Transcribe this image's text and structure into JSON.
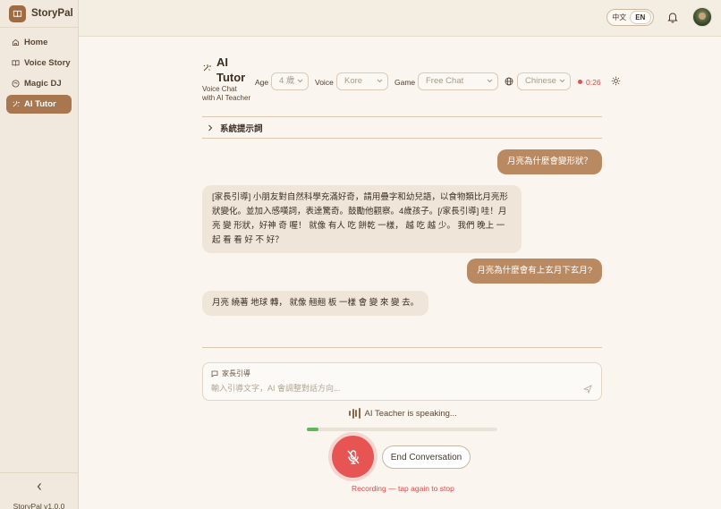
{
  "app": {
    "name": "StoryPal",
    "version": "StoryPal v1.0.0"
  },
  "sidebar": {
    "items": [
      {
        "label": "Home",
        "icon": "home-icon",
        "active": false
      },
      {
        "label": "Voice Story",
        "icon": "book-icon",
        "active": false
      },
      {
        "label": "Magic DJ",
        "icon": "disc-icon",
        "active": false
      },
      {
        "label": "AI Tutor",
        "icon": "sparkle-icon",
        "active": true
      }
    ]
  },
  "topbar": {
    "lang_zh": "中文",
    "lang_en": "EN",
    "active_lang": "EN"
  },
  "tutor": {
    "title": "AI Tutor",
    "subtitle": "Voice Chat with AI Teacher",
    "age_label": "Age",
    "age_value": "4 歲",
    "voice_label": "Voice",
    "voice_value": "Kore",
    "game_label": "Game",
    "game_value": "Free Chat",
    "language_value": "Chinese",
    "timer": "0:26"
  },
  "system_prompt": {
    "label": "系統提示詞"
  },
  "messages": [
    {
      "role": "user",
      "text": "月亮為什麼會變形狀？"
    },
    {
      "role": "ai",
      "text": "[家長引導] 小朋友對自然科學充滿好奇，請用疊字和幼兒語，以食物類比月亮形狀變化。並加入感嘆詞，表達驚奇。鼓勵他觀察。4歲孩子。[/家長引導] 哇！月亮 變 形狀，好神 奇 喔！ 就像 有人 吃 餅乾 一樣， 越 吃 越 少。 我們 晚上 一起 看 看 好 不 好？"
    },
    {
      "role": "user",
      "text": "月亮為什麼會有上玄月下玄月?"
    },
    {
      "role": "ai",
      "text": "月亮 繞著 地球 轉， 就像 翹翹 板 一樣 會 變 來 變 去。"
    }
  ],
  "guide": {
    "label": "家長引導",
    "placeholder": "輸入引導文字，AI 會調整對話方向..."
  },
  "status": {
    "speaking": "AI Teacher is speaking...",
    "progress": 0.06
  },
  "controls": {
    "end_label": "End Conversation",
    "recording_hint": "Recording — tap again to stop"
  },
  "colors": {
    "accent": "#a8774f",
    "user_bubble": "#b98a62",
    "ai_bubble": "#efe6d9",
    "record": "#e65454"
  }
}
